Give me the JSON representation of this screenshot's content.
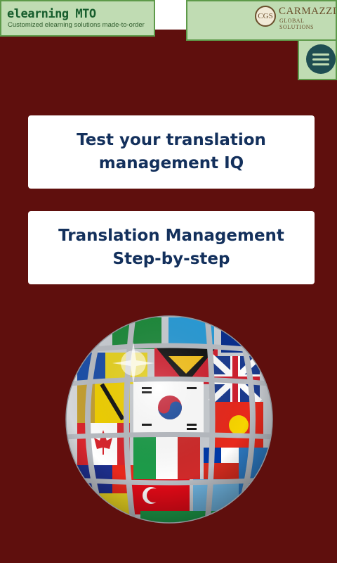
{
  "header": {
    "brand_title": "elearning MTO",
    "brand_tagline": "Customized elearning solutions made-to-order",
    "partner_badge": "CGS",
    "partner_name": "CARMAZZI",
    "partner_subtitle": "GLOBAL SOLUTIONS"
  },
  "menu": {
    "icon": "hamburger-menu-icon"
  },
  "cards": [
    {
      "line1": "Test your translation",
      "line2": "management IQ"
    },
    {
      "line1": "Translation Management",
      "line2": "Step-by-step"
    }
  ],
  "globe": {
    "icon": "flags-globe"
  },
  "colors": {
    "background": "#5f0f0d",
    "logo_bg": "#c0dcb3",
    "logo_border": "#5e9a4a",
    "card_text": "#13305c",
    "menu_circle": "#1f4e52"
  }
}
